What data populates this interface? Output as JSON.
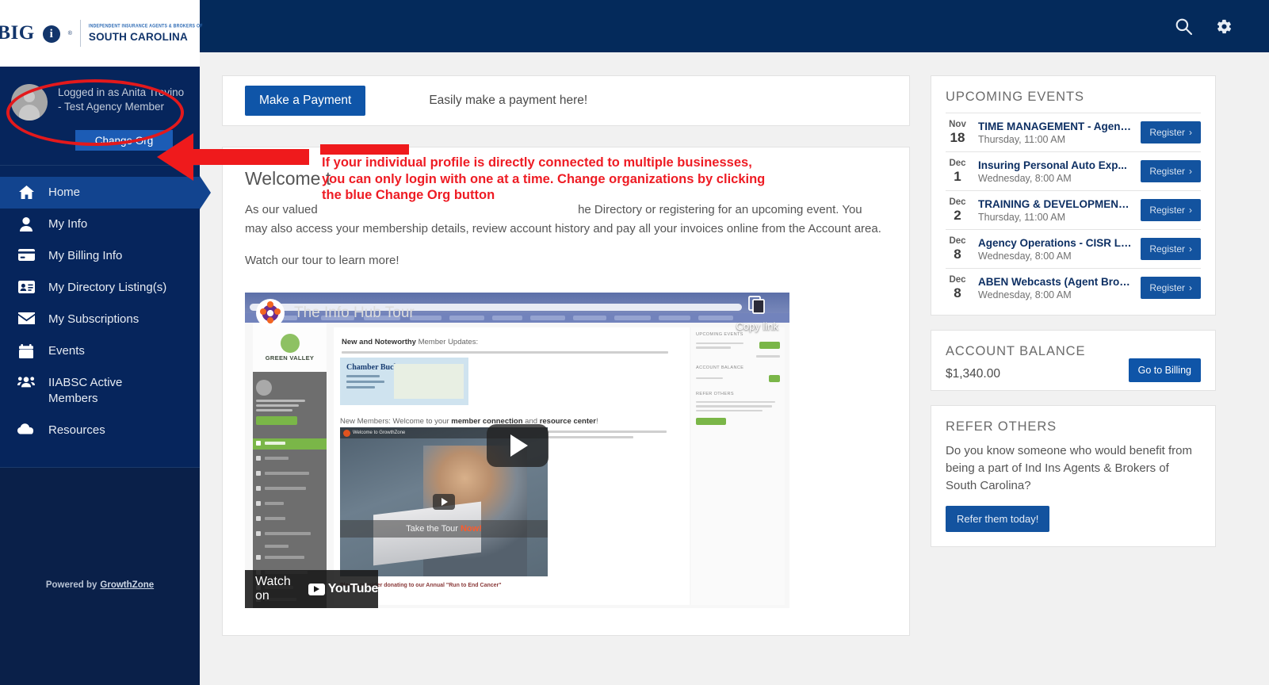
{
  "brand": {
    "logo_big": "BIG",
    "logo_i": "i",
    "logo_tm": "®",
    "logo_sub_top": "INDEPENDENT INSURANCE AGENTS & BROKERS OF",
    "logo_sub_bottom": "SOUTH CAROLINA",
    "accent_navy": "#042a5b",
    "accent_blue": "#0f55a8",
    "annotation_red": "#ee1c24"
  },
  "header": {
    "search_icon": "search-icon",
    "settings_icon": "gear-icon"
  },
  "user": {
    "logged_in_label": "Logged in as",
    "name": "Anita Trevino - Test",
    "org": "Agency Member",
    "full_text": "Logged in as\nAnita Trevino - Test\nAgency Member",
    "change_org_label": "Change Org"
  },
  "sidebar": {
    "items": [
      {
        "label": "Home",
        "icon": "home-icon",
        "active": true
      },
      {
        "label": "My Info",
        "icon": "person-icon",
        "active": false
      },
      {
        "label": "My Billing Info",
        "icon": "credit-card-icon",
        "active": false
      },
      {
        "label": "My Directory Listing(s)",
        "icon": "id-card-icon",
        "active": false
      },
      {
        "label": "My Subscriptions",
        "icon": "envelope-icon",
        "active": false
      },
      {
        "label": "Events",
        "icon": "calendar-icon",
        "active": false
      },
      {
        "label": "IIABSC Active\nMembers",
        "icon": "people-icon",
        "active": false
      },
      {
        "label": "Resources",
        "icon": "cloud-icon",
        "active": false
      }
    ],
    "footer_prefix": "Powered by",
    "footer_link": "GrowthZone"
  },
  "payment": {
    "button_label": "Make a Payment",
    "hint": "Easily make a payment here!"
  },
  "welcome": {
    "title": "Welcome t",
    "paragraph_line1_left": "As our valued",
    "paragraph_line1_right": "he Directory or",
    "paragraph_line2": "registering for an upcoming event. You may also access your membership details, review account history and pay all your",
    "paragraph_line3": "invoices online from the Account area.",
    "tour_line": "Watch our tour to learn more!"
  },
  "video": {
    "title": "The Info Hub Tour",
    "copy_link_label": "Copy link",
    "watch_on_label": "Watch on",
    "youtube_label": "YouTube",
    "play_icon": "play-button-icon",
    "copy_icon": "copy-link-icon",
    "inner": {
      "heading_bold": "New and Noteworthy",
      "heading_rest": " Member Updates:",
      "chamber_title": "Chamber Bucks",
      "members_line_pre": "New Members: Welcome to your ",
      "members_line_bold1": "member connection",
      "members_line_mid": " and ",
      "members_line_bold2": "resource center",
      "members_line_end": "!",
      "logo_text": "GREEN VALLEY",
      "video_caption": "Take the Tour",
      "video_caption_hl": "Now!",
      "video_topbar": "Welcome to GrowthZone",
      "bottom_note": "Please consider donating to our Annual \"Run to End Cancer\"",
      "right_titles": [
        "UPCOMING EVENTS",
        "ACCOUNT BALANCE",
        "REFER OTHERS"
      ]
    }
  },
  "events_panel": {
    "title": "UPCOMING EVENTS",
    "register_label": "Register",
    "items": [
      {
        "month": "Nov",
        "day": "18",
        "name": "TIME MANAGEMENT - Agenc...",
        "when": "Thursday, 11:00 AM"
      },
      {
        "month": "Dec",
        "day": "1",
        "name": "Insuring Personal Auto Exp...",
        "when": "Wednesday, 8:00 AM"
      },
      {
        "month": "Dec",
        "day": "2",
        "name": "TRAINING & DEVELOPMENT ...",
        "when": "Thursday, 11:00 AM"
      },
      {
        "month": "Dec",
        "day": "8",
        "name": "Agency Operations - CISR Li...",
        "when": "Wednesday, 8:00 AM"
      },
      {
        "month": "Dec",
        "day": "8",
        "name": "ABEN Webcasts (Agent Brok...",
        "when": "Wednesday, 8:00 AM"
      }
    ]
  },
  "balance_panel": {
    "title": "ACCOUNT BALANCE",
    "amount": "$1,340.00",
    "button_label": "Go to Billing"
  },
  "refer_panel": {
    "title": "REFER OTHERS",
    "text": "Do you know someone who would benefit from being a part of Ind Ins Agents & Brokers of South Carolina?",
    "button_label": "Refer them today!"
  },
  "annotation": {
    "line1": "If your individual profile is directly connected to multiple businesses,",
    "line2": "you can only login with one at a time. Change organizations by clicking",
    "line3": "the blue Change Org button"
  }
}
